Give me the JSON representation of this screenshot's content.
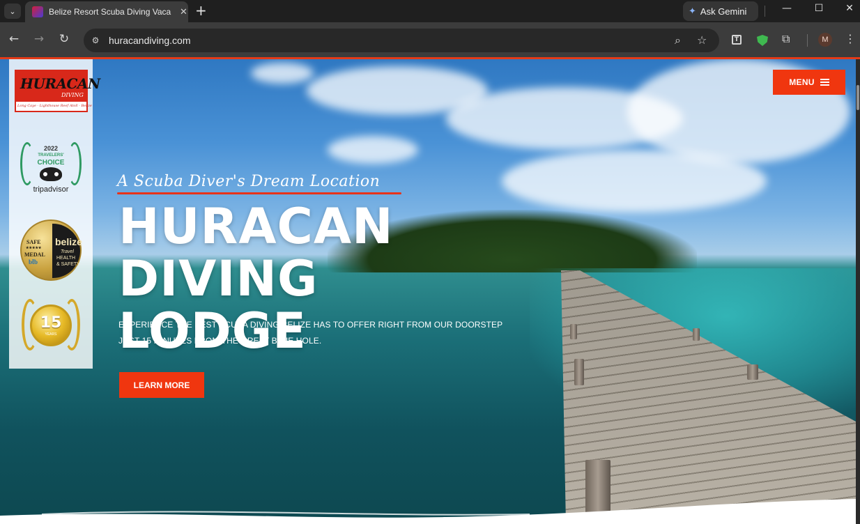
{
  "browser": {
    "tab_title": "Belize Resort Scuba Diving Vaca",
    "ask_gemini_label": "Ask Gemini",
    "url": "huracandiving.com",
    "profile_initial": "M"
  },
  "site": {
    "logo": {
      "name": "HURACAN",
      "sub": "DIVING",
      "tag": "Long Caye - Lighthouse Reef Atoll - Belize"
    },
    "badges": {
      "tripadvisor": {
        "year": "2022",
        "label": "TRAVELERS'",
        "choice": "CHOICE",
        "brand": "tripadvisor"
      },
      "safe_medal": {
        "safe": "SAFE",
        "stars": "★★★★★",
        "medal": "MEDAL",
        "belize": "belize",
        "bto": "bt̃b",
        "travel": "Travel",
        "health": "HEALTH",
        "safety": "& SAFETY"
      },
      "anniversary": {
        "number": "15",
        "word": "YEARS"
      }
    },
    "menu_label": "MENU",
    "hero": {
      "tagline": "A Scuba Diver's Dream Location",
      "headline_line1": "HURACAN",
      "headline_line2": "DIVING LODGE",
      "subtext": "EXPERIENCE THE BEST SCUBA DIVING BELIZE HAS TO OFFER RIGHT FROM OUR DOORSTEP JUST 15 MINUTES FROM THE GREAT BLUE HOLE.",
      "cta_label": "LEARN MORE"
    }
  },
  "colors": {
    "accent": "#f0360f",
    "tripadvisor_green": "#2f9a62",
    "gold": "#c9a23f"
  }
}
